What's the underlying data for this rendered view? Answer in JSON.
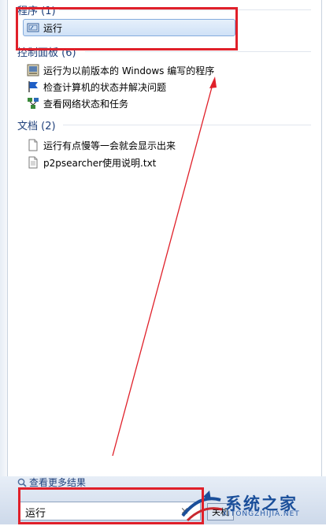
{
  "groups": {
    "programs": {
      "header": "程序 (1)",
      "items": [
        {
          "label": "运行",
          "icon": "run-icon"
        }
      ]
    },
    "control_panel": {
      "header": "控制面板 (6)",
      "items": [
        {
          "label": "运行为以前版本的 Windows 编写的程序",
          "icon": "compatibility-icon"
        },
        {
          "label": "检查计算机的状态并解决问题",
          "icon": "action-center-flag-icon"
        },
        {
          "label": "查看网络状态和任务",
          "icon": "network-icon"
        }
      ]
    },
    "documents": {
      "header": "文档 (2)",
      "items": [
        {
          "label": "运行有点慢等一会就会显示出来",
          "icon": "text-document-icon"
        },
        {
          "label": "p2psearcher使用说明.txt",
          "icon": "text-document-icon"
        }
      ]
    }
  },
  "more_results": "查看更多结果",
  "search": {
    "value": "运行"
  },
  "clear_glyph": "×",
  "watermark": {
    "cn": "系统之家",
    "en": "XITONGZHIJIA.NET",
    "button_text": "关机"
  },
  "colors": {
    "highlight": "#e0202a",
    "header_text": "#1e3f7a",
    "selection": "#cfe1f7"
  }
}
